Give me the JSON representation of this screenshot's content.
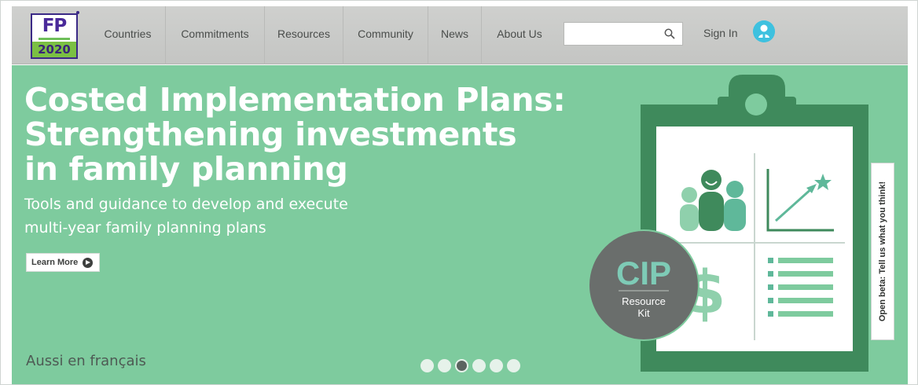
{
  "brand": {
    "logo_text": "FP",
    "logo_year": "2020"
  },
  "nav": {
    "items": [
      {
        "label": "Countries"
      },
      {
        "label": "Commitments"
      },
      {
        "label": "Resources"
      },
      {
        "label": "Community"
      },
      {
        "label": "News"
      },
      {
        "label": "About Us"
      }
    ],
    "search": {
      "value": "",
      "placeholder": "",
      "icon": "search-icon"
    },
    "sign_in_label": "Sign In",
    "sign_in_icon": "user-icon"
  },
  "hero": {
    "title_lines": [
      "Costed Implementation Plans:",
      "Strengthening investments",
      "in family planning"
    ],
    "subtitle_lines": [
      "Tools and guidance to develop and execute",
      "multi-year family planning plans"
    ],
    "learn_more_label": "Learn More",
    "language_link": "Aussi en français",
    "carousel": {
      "count": 6,
      "active_index": 2
    },
    "badge": {
      "title": "CIP",
      "line1": "Resource",
      "line2": "Kit"
    },
    "feedback_label": "Open beta: Tell us what you think!"
  },
  "colors": {
    "hero_bg": "#7ecb9e",
    "clipboard_dark": "#3f8a5c",
    "icon_teal": "#5fb89a",
    "badge_grey": "#6a6e6c",
    "nav_bg": "#c9cac8",
    "brand_purple": "#4a2a9a",
    "brand_green": "#7bc043"
  }
}
